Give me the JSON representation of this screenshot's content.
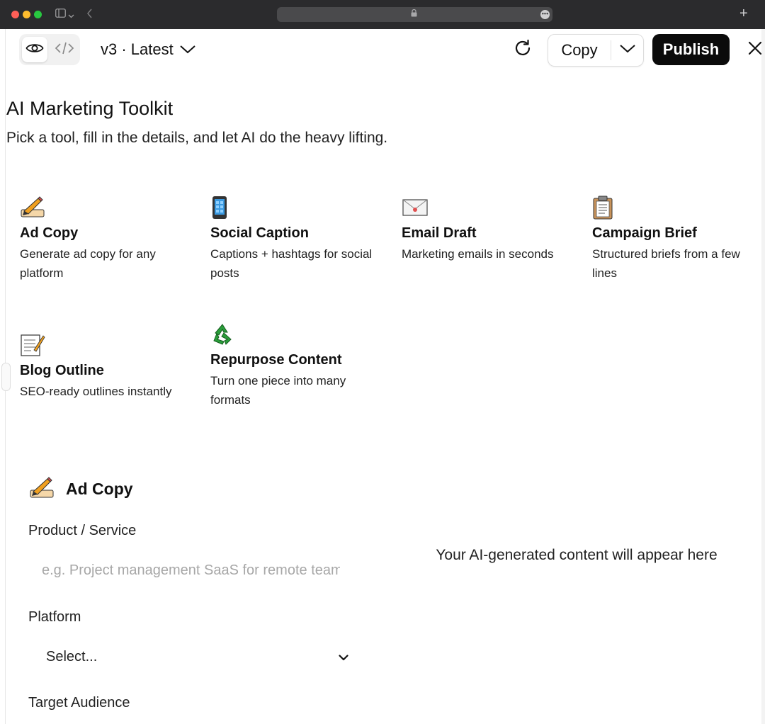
{
  "browser": {
    "url_icon": "lock-icon",
    "new_tab_label": "+"
  },
  "toolbar": {
    "version_label": "v3 · Latest",
    "copy_label": "Copy",
    "publish_label": "Publish"
  },
  "page": {
    "title": "AI Marketing Toolkit",
    "subtitle": "Pick a tool, fill in the details, and let AI do the heavy lifting."
  },
  "tools": [
    {
      "emoji": "✍️",
      "name": "Ad Copy",
      "desc": "Generate ad copy for any platform"
    },
    {
      "emoji": "📱",
      "name": "Social Caption",
      "desc": "Captions + hashtags for social posts"
    },
    {
      "emoji": "📧",
      "name": "Email Draft",
      "desc": "Marketing emails in seconds"
    },
    {
      "emoji": "📋",
      "name": "Campaign Brief",
      "desc": "Structured briefs from a few lines"
    },
    {
      "emoji": "📝",
      "name": "Blog Outline",
      "desc": "SEO-ready outlines instantly"
    },
    {
      "emoji": "♻️",
      "name": "Repurpose Content",
      "desc": "Turn one piece into many formats"
    }
  ],
  "form": {
    "emoji": "✍️",
    "title": "Ad Copy",
    "product_label": "Product / Service",
    "product_placeholder": "e.g. Project management SaaS for remote teams",
    "product_value": "",
    "platform_label": "Platform",
    "platform_value": "Select...",
    "audience_label": "Target Audience"
  },
  "output": {
    "placeholder": "Your AI-generated content will appear here"
  },
  "colors": {
    "publish_bg": "#0b0b0b",
    "chrome_bg": "#2b2b2d"
  }
}
